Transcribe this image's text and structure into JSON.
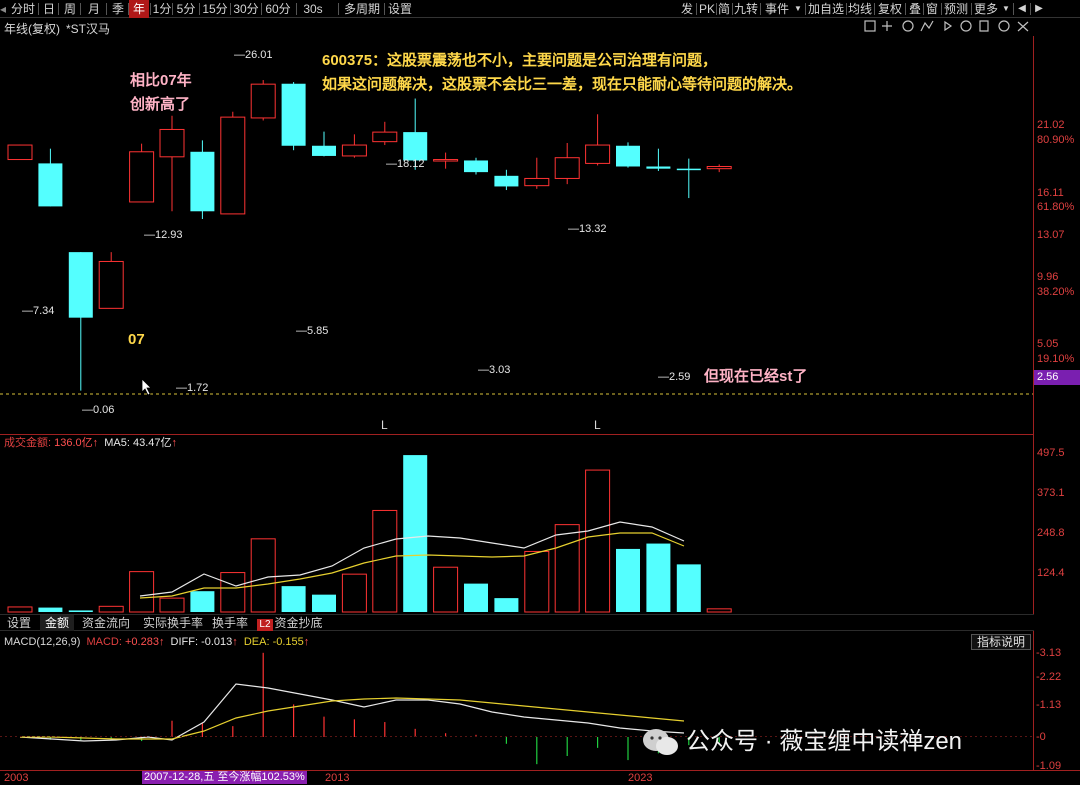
{
  "toolbar": {
    "left_items": [
      "分时",
      "日",
      "周",
      "月",
      "季",
      "年",
      "1分",
      "5分",
      "15分",
      "30分",
      "60分",
      "30s",
      "多周期",
      "设置"
    ],
    "active": "年",
    "right_items": [
      "发",
      "PK",
      "简",
      "九转",
      "事件",
      "加自选",
      "均线",
      "复权",
      "叠",
      "窗",
      "预测",
      "更多"
    ]
  },
  "chart_header": {
    "period": "年线(复权)",
    "stock": "*ST汉马"
  },
  "annotations": {
    "top_note_line1": "600375：这股票震荡也不小，主要问题是公司治理有问题，",
    "top_note_line2": "如果这问题解决，这股票不会比三一差，现在只能耐心等待问题的解决。",
    "left_note_line1": "相比07年",
    "left_note_line2": "创新高了",
    "year_mark": "07",
    "bottom_note": "但现在已经st了",
    "l_marker_1": "L",
    "l_marker_2": "L"
  },
  "price_labels": {
    "p1": "7.34",
    "p2": "0.06",
    "p3": "12.93",
    "p4": "1.72",
    "p5": "26.01",
    "p6": "5.85",
    "p7": "18.12",
    "p8": "3.03",
    "p9": "13.32",
    "p10": "2.59"
  },
  "price_axis": {
    "p2102": "21.02",
    "pct8090": "80.90%",
    "p1611": "16.11",
    "pct6180": "61.80%",
    "p1307": "13.07",
    "p996": "9.96",
    "pct3820": "38.20%",
    "p505": "5.05",
    "pct1910": "19.10%",
    "current": "2.56"
  },
  "volume": {
    "title": "成交金额",
    "value": "136.0亿",
    "ma5_label": "MA5:",
    "ma5_value": "43.47亿",
    "arrow": "↑",
    "axis": [
      "497.5",
      "373.1",
      "248.8",
      "124.4"
    ]
  },
  "tabs": [
    "设置",
    "金额",
    "资金流向",
    "实际换手率",
    "换手率",
    "资金抄底"
  ],
  "active_tab": "金额",
  "tab_badge": "L2",
  "macd": {
    "title": "MACD(12,26,9)",
    "macd_label": "MACD:",
    "macd_value": "+0.283",
    "diff_label": "DIFF:",
    "diff_value": "-0.013",
    "dea_label": "DEA:",
    "dea_value": "-0.155",
    "arrow": "↑",
    "axis": [
      "3.13",
      "2.22",
      "1.13",
      "0",
      "-1.09"
    ],
    "explain_button": "指标说明"
  },
  "time_axis": {
    "start": "2003",
    "mid": "2013",
    "end": "2023",
    "highlight": "2007-12-28,五 至今涨幅102.53%"
  },
  "watermark": "公众号 · 薇宝缠中读禅zen",
  "colors": {
    "up": "#ff3333",
    "down": "#54ffff",
    "accent_red": "#b01818",
    "yellow": "#ffd84a",
    "pink": "#ffb3c6",
    "purple": "#7a1fb0"
  },
  "chart_data": {
    "type": "candlestick",
    "candles": [
      {
        "o": 5.5,
        "c": 7.3,
        "h": 7.34,
        "l": 5.5
      },
      {
        "o": 5.1,
        "c": 2.2,
        "h": 6.8,
        "l": 2.2
      },
      {
        "o": 0.9,
        "c": 0.25,
        "h": 0.9,
        "l": 0.06
      },
      {
        "o": 0.3,
        "c": 0.75,
        "h": 0.9,
        "l": 0.3
      },
      {
        "o": 2.4,
        "c": 6.4,
        "h": 7.5,
        "l": 2.4
      },
      {
        "o": 5.8,
        "c": 9.9,
        "h": 12.93,
        "l": 2.0
      },
      {
        "o": 6.4,
        "c": 2.0,
        "h": 8.0,
        "l": 1.72
      },
      {
        "o": 1.9,
        "c": 12.6,
        "h": 14.0,
        "l": 1.9
      },
      {
        "o": 12.4,
        "c": 24.0,
        "h": 26.01,
        "l": 11.8
      },
      {
        "o": 24.2,
        "c": 7.2,
        "h": 25.0,
        "l": 6.6
      },
      {
        "o": 7.2,
        "c": 5.9,
        "h": 9.5,
        "l": 5.85
      },
      {
        "o": 5.9,
        "c": 7.3,
        "h": 9.0,
        "l": 5.7
      },
      {
        "o": 7.8,
        "c": 9.4,
        "h": 11.5,
        "l": 7.3
      },
      {
        "o": 9.4,
        "c": 5.4,
        "h": 18.12,
        "l": 4.5
      },
      {
        "o": 5.4,
        "c": 5.5,
        "h": 6.3,
        "l": 4.6
      },
      {
        "o": 5.4,
        "c": 4.3,
        "h": 5.7,
        "l": 4.1
      },
      {
        "o": 4.0,
        "c": 3.25,
        "h": 4.5,
        "l": 3.03
      },
      {
        "o": 3.3,
        "c": 3.8,
        "h": 5.7,
        "l": 3.1
      },
      {
        "o": 3.8,
        "c": 5.7,
        "h": 7.6,
        "l": 3.4
      },
      {
        "o": 5.1,
        "c": 7.3,
        "h": 13.32,
        "l": 4.9
      },
      {
        "o": 7.2,
        "c": 4.8,
        "h": 7.7,
        "l": 4.7
      },
      {
        "o": 4.8,
        "c": 4.6,
        "h": 6.8,
        "l": 4.4
      },
      {
        "o": 4.6,
        "c": 4.5,
        "h": 5.6,
        "l": 2.59
      },
      {
        "o": 4.6,
        "c": 4.8,
        "h": 5.0,
        "l": 4.3
      }
    ],
    "volumes": [
      16,
      14,
      5,
      18,
      128,
      44,
      66,
      125,
      232,
      82,
      55,
      120,
      322,
      497.5,
      142,
      90,
      44,
      192,
      277,
      450,
      200,
      217,
      151,
      10
    ],
    "macd_hist": [
      0,
      -0.1,
      -0.12,
      -0.05,
      -0.15,
      0.6,
      0.5,
      0.4,
      3.1,
      1.2,
      0.75,
      0.65,
      0.55,
      0.3,
      0.14,
      0.08,
      -0.25,
      -1.0,
      -0.7,
      -0.4,
      -0.85,
      -0.6,
      -0.3,
      -0.2
    ],
    "price_ylim": [
      0.05,
      45
    ],
    "price_scale": "log",
    "volume_ylim": [
      0,
      520
    ],
    "macd_ylim": [
      -1.09,
      3.13
    ]
  }
}
